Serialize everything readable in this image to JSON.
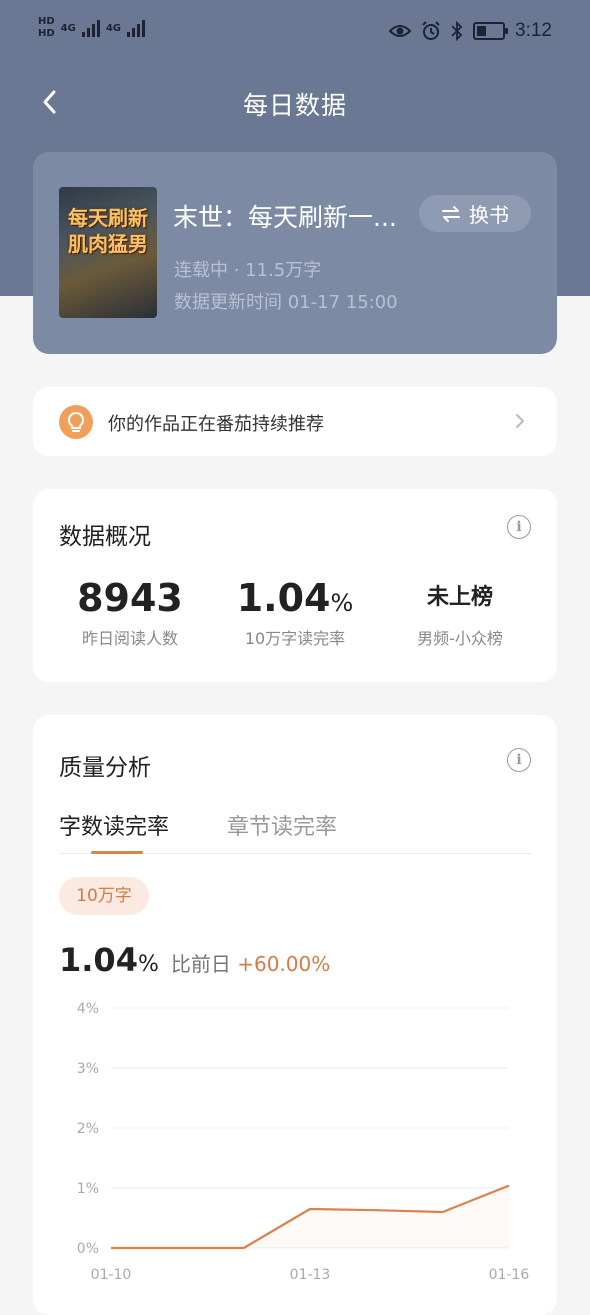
{
  "status_bar": {
    "network_labels": [
      "HD",
      "HD"
    ],
    "net_type": "4G",
    "time": "3:12",
    "icons": [
      "eye-icon",
      "alarm-icon",
      "bluetooth-icon",
      "battery-icon"
    ]
  },
  "header": {
    "title": "每日数据",
    "back_icon": "chevron-left-icon"
  },
  "book": {
    "title": "末世：每天刷新一...",
    "cover_text": "每天刷新肌肉猛男",
    "status": "连载中 · 11.5万字",
    "update_time": "数据更新时间 01-17 15:00",
    "switch_label": "换书",
    "switch_icon": "swap-icon"
  },
  "recommend": {
    "text": "你的作品正在番茄持续推荐",
    "icon": "lightbulb-icon"
  },
  "overview": {
    "title": "数据概况",
    "stats": [
      {
        "value": "8943",
        "unit": "",
        "label": "昨日阅读人数"
      },
      {
        "value": "1.04",
        "unit": "%",
        "label": "10万字读完率"
      },
      {
        "value": "未上榜",
        "unit": "",
        "label": "男频-小众榜"
      }
    ]
  },
  "quality": {
    "title": "质量分析",
    "tabs": [
      "字数读完率",
      "章节读完率"
    ],
    "active_tab": 0,
    "chip": "10万字",
    "rate": "1.04",
    "rate_unit": "%",
    "compare_label": "比前日",
    "compare_value": "+60.00%"
  },
  "colors": {
    "header_bg": "#6a7893",
    "accent": "#d9824a",
    "page_bg": "#f5f5f5"
  },
  "chart_data": {
    "type": "line",
    "x": [
      "01-10",
      "01-11",
      "01-12",
      "01-13",
      "01-14",
      "01-15",
      "01-16"
    ],
    "x_tick_labels": [
      "01-10",
      "01-13",
      "01-16"
    ],
    "y_tick_labels": [
      "0%",
      "1%",
      "2%",
      "3%",
      "4%"
    ],
    "series": [
      {
        "values": [
          0,
          0,
          0,
          0.65,
          0.63,
          0.6,
          1.04
        ]
      }
    ],
    "ylim": [
      0,
      4
    ],
    "grid": true
  }
}
